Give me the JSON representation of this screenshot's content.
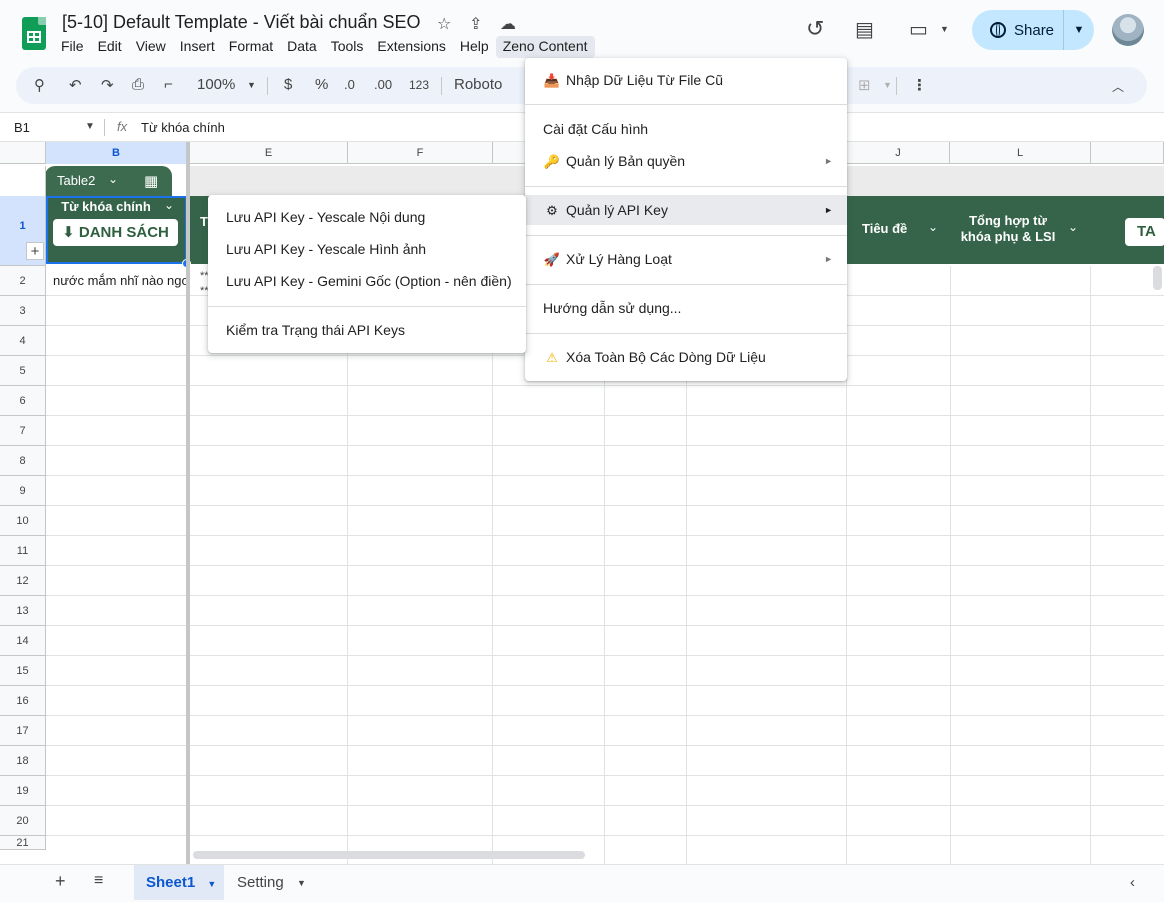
{
  "header": {
    "doc_title": "[5-10] Default Template - Viết bài chuẩn SEO",
    "share_label": "Share",
    "menus": [
      "File",
      "Edit",
      "View",
      "Insert",
      "Format",
      "Data",
      "Tools",
      "Extensions",
      "Help",
      "Zeno Content"
    ]
  },
  "toolbar": {
    "zoom": "100%",
    "currency": "$",
    "percent": "%",
    "dec_decrease": ".0",
    "dec_increase": ".00",
    "number_format": "123",
    "font": "Roboto"
  },
  "formula_bar": {
    "cell_ref": "B1",
    "fx": "fx",
    "content": "Từ khóa chính"
  },
  "grid": {
    "columns": [
      "B",
      "E",
      "F",
      "J",
      "L"
    ],
    "rows": [
      "1",
      "2",
      "3",
      "4",
      "5",
      "6",
      "7",
      "8",
      "9",
      "10",
      "11",
      "12",
      "13",
      "14",
      "15",
      "16",
      "17",
      "18",
      "19",
      "20",
      "21"
    ],
    "table_name": "Table2",
    "header_b": "Từ khóa chính",
    "danh_sach_label": "DANH SÁCH",
    "header_e_partial": "T",
    "header_tieu_de": "Tiêu đề",
    "header_tong_hop_1": "Tổng hợp từ",
    "header_tong_hop_2": "khóa phụ & LSI",
    "tai_btn": "TA",
    "cell_b2": "nước mắm nhĩ nào ngon",
    "cell_e2_1": "**",
    "cell_e2_2": "**"
  },
  "bottom": {
    "sheets": [
      "Sheet1",
      "Setting"
    ]
  },
  "zeno_menu": {
    "items": [
      {
        "label": "Nhập Dữ Liệu Từ File Cũ",
        "icon": "inbox-tray-icon"
      },
      {
        "label": "Cài đặt Cấu hình",
        "icon": ""
      },
      {
        "label": "Quản lý Bản quyền",
        "icon": "key-icon"
      },
      {
        "label": "Quản lý API Key",
        "icon": "gear-icon"
      },
      {
        "label": "Xử Lý Hàng Loạt",
        "icon": "rocket-icon"
      },
      {
        "label": "Hướng dẫn sử dụng...",
        "icon": ""
      },
      {
        "label": "Xóa Toàn Bộ Các Dòng Dữ Liệu",
        "icon": "warning-icon"
      }
    ]
  },
  "api_submenu": {
    "items": [
      "Lưu API Key - Yescale Nội dung",
      "Lưu API Key - Yescale Hình ảnh",
      "Lưu API Key - Gemini Gốc (Option - nên điền)",
      "Kiểm tra Trạng thái API Keys"
    ]
  }
}
